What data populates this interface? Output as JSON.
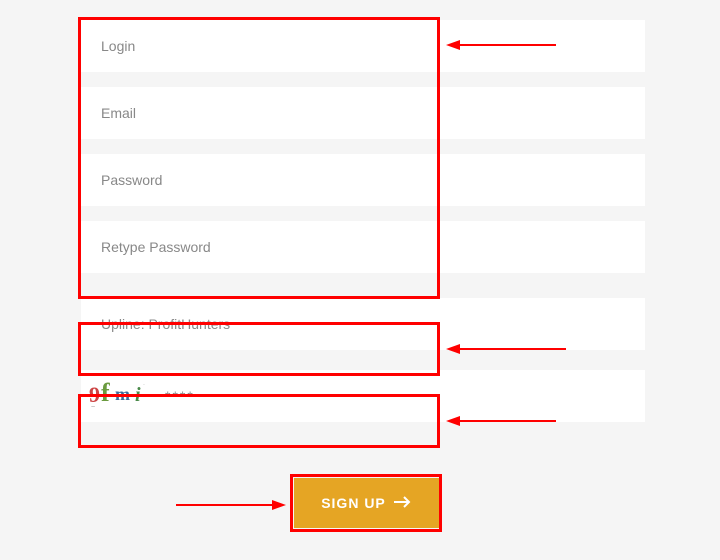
{
  "fields": {
    "login": {
      "placeholder": "Login"
    },
    "email": {
      "placeholder": "Email"
    },
    "password": {
      "placeholder": "Password"
    },
    "retype_password": {
      "placeholder": "Retype Password"
    },
    "upline": {
      "text": "Upline: ProfitHunters"
    },
    "captcha": {
      "placeholder": "****",
      "image_text": "9fmi"
    }
  },
  "button": {
    "signup_label": "SIGN UP"
  },
  "colors": {
    "accent": "#e5a524",
    "annotation": "#ff0000"
  }
}
